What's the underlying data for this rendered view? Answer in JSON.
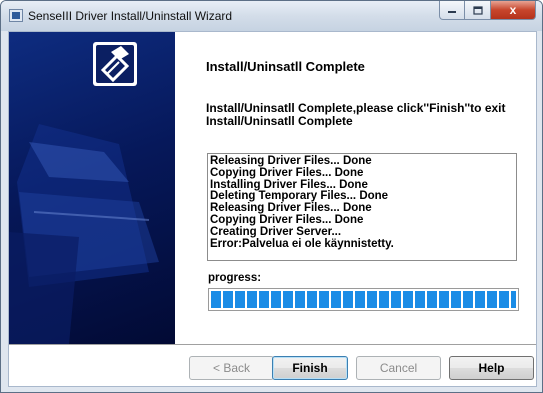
{
  "window": {
    "title": "SenseIII Driver Install/Uninstall Wizard",
    "close_glyph": "x"
  },
  "page": {
    "heading": "Install/Uninsatll Complete",
    "description": "Install/Uninsatll Complete,please click''Finish''to exit Install/Uninsatll Complete"
  },
  "log": {
    "lines": [
      "Releasing Driver Files... Done",
      "Copying Driver Files... Done",
      "Installing Driver Files... Done",
      "Deleting Temporary Files... Done",
      "Releasing Driver Files... Done",
      "Copying Driver Files... Done",
      "Creating Driver Server...",
      "Error:Palvelua ei ole käynnistetty."
    ]
  },
  "progress": {
    "label": "progress:",
    "value_percent": 100,
    "segment_color": "#1a8ce6"
  },
  "buttons": {
    "back": "< Back",
    "finish": "Finish",
    "cancel": "Cancel",
    "help": "Help"
  },
  "colors": {
    "sidebar": "#06185a",
    "title_close": "#c7452c"
  }
}
